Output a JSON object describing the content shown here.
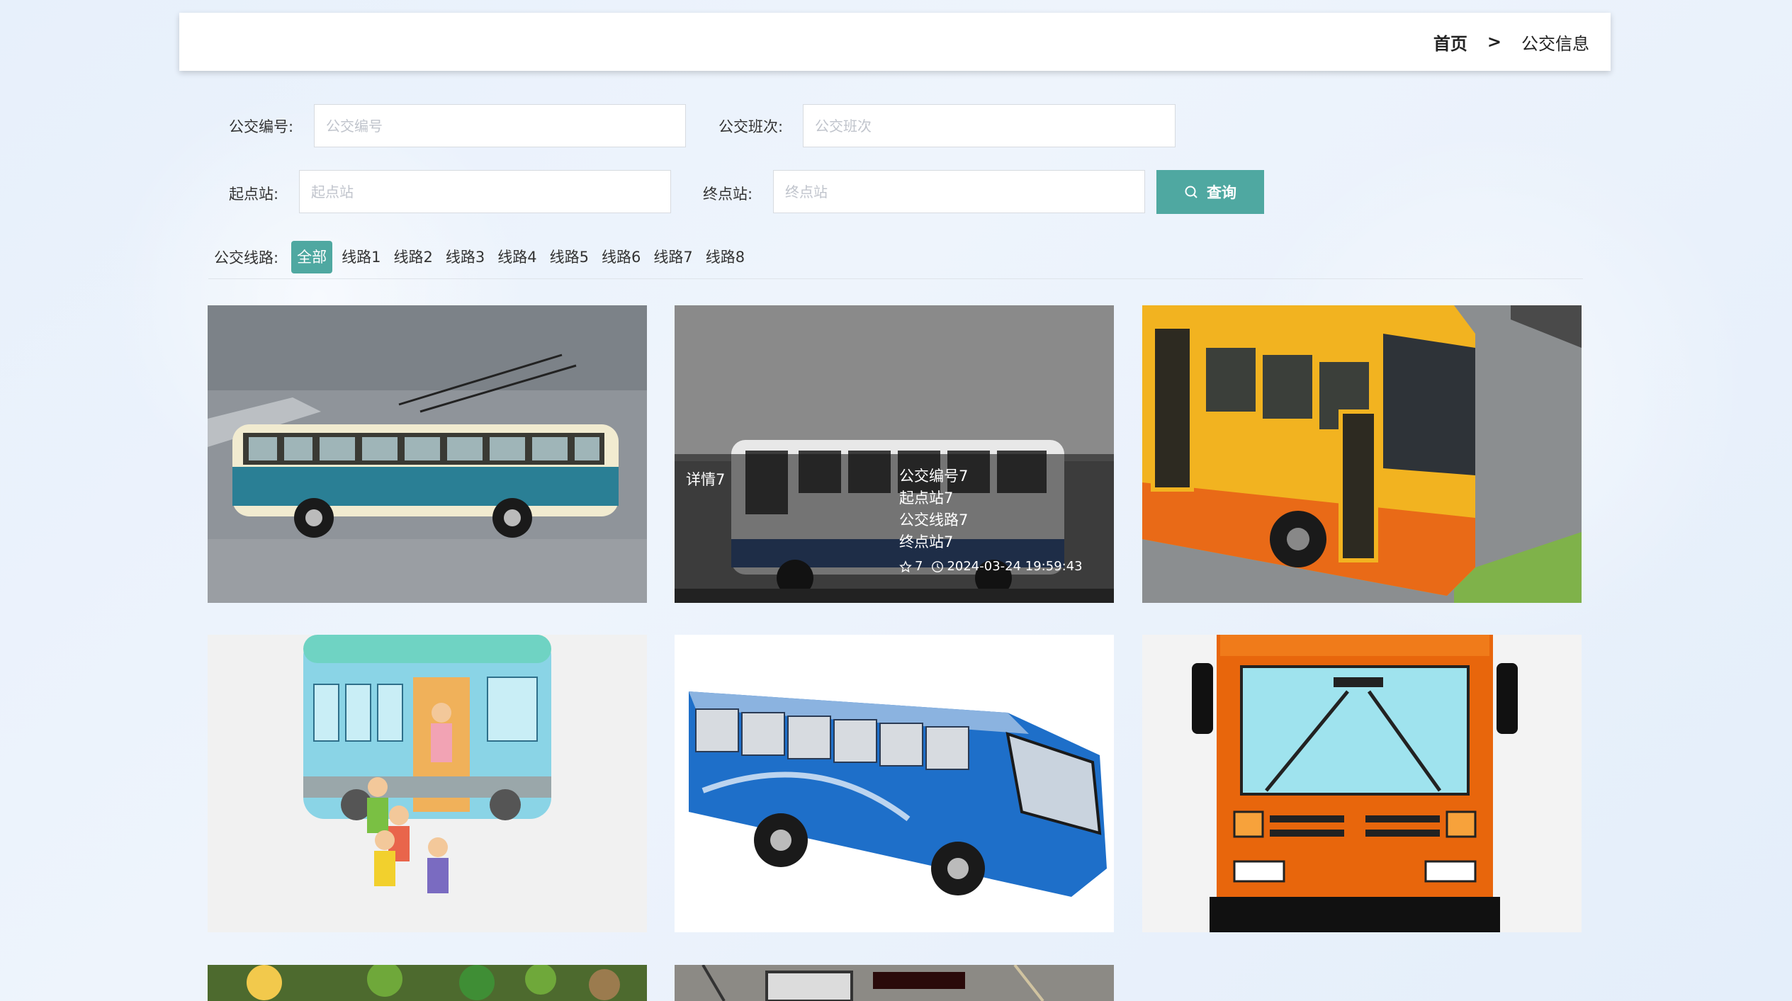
{
  "breadcrumb": {
    "home": "首页",
    "separator": ">",
    "current": "公交信息"
  },
  "search": {
    "bus_number": {
      "label": "公交编号:",
      "placeholder": "公交编号"
    },
    "bus_trip": {
      "label": "公交班次:",
      "placeholder": "公交班次"
    },
    "start_station": {
      "label": "起点站:",
      "placeholder": "起点站"
    },
    "end_station": {
      "label": "终点站:",
      "placeholder": "终点站"
    },
    "button_label": "查询"
  },
  "routes": {
    "label": "公交线路:",
    "items": [
      "全部",
      "线路1",
      "线路2",
      "线路3",
      "线路4",
      "线路5",
      "线路6",
      "线路7",
      "线路8"
    ],
    "active": "全部"
  },
  "cards": [
    {
      "image": "trolleybus-model"
    },
    {
      "image": "bus-model-dark",
      "overlay": {
        "detail": "详情7",
        "bus_number": "公交编号7",
        "start_station": "起点站7",
        "route": "公交线路7",
        "end_station": "终点站7",
        "favorites": "7",
        "time": "2024-03-24 19:59:43"
      }
    },
    {
      "image": "yellow-city-bus"
    },
    {
      "image": "cartoon-bus-children"
    },
    {
      "image": "blue-coach-model"
    },
    {
      "image": "orange-bus-front"
    },
    {
      "image": "bus-photo-partial"
    },
    {
      "image": "bus-interior-partial"
    }
  ],
  "colors": {
    "accent": "#4fa8a1",
    "background": "#e9f1fb"
  }
}
